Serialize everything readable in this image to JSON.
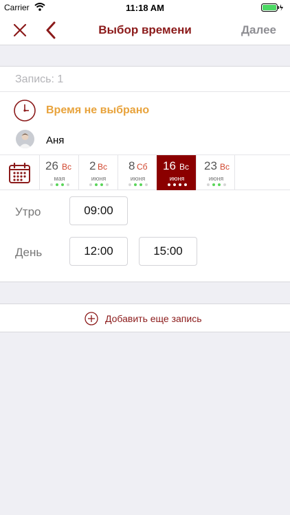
{
  "status_bar": {
    "carrier": "Carrier",
    "time": "11:18 AM"
  },
  "nav": {
    "title": "Выбор времени",
    "next_label": "Далее"
  },
  "appointment": {
    "record_label": "Запись: 1",
    "time_status": "Время не выбрано",
    "person_name": "Аня"
  },
  "dates": [
    {
      "day": "26",
      "weekday": "Вс",
      "month": "мая",
      "selected": false
    },
    {
      "day": "2",
      "weekday": "Вс",
      "month": "июня",
      "selected": false
    },
    {
      "day": "8",
      "weekday": "Сб",
      "month": "июня",
      "selected": false
    },
    {
      "day": "16",
      "weekday": "Вс",
      "month": "июня",
      "selected": true
    },
    {
      "day": "23",
      "weekday": "Вс",
      "month": "июня",
      "selected": false
    }
  ],
  "time_slots": {
    "morning": {
      "label": "Утро",
      "times": [
        "09:00"
      ]
    },
    "day": {
      "label": "День",
      "times": [
        "12:00",
        "15:00"
      ]
    }
  },
  "add_record_label": "Добавить еще запись",
  "colors": {
    "accent": "#8b1a1a",
    "selected_date": "#8b0000",
    "warning": "#e8a33c",
    "available_dot": "#5ad55a"
  }
}
